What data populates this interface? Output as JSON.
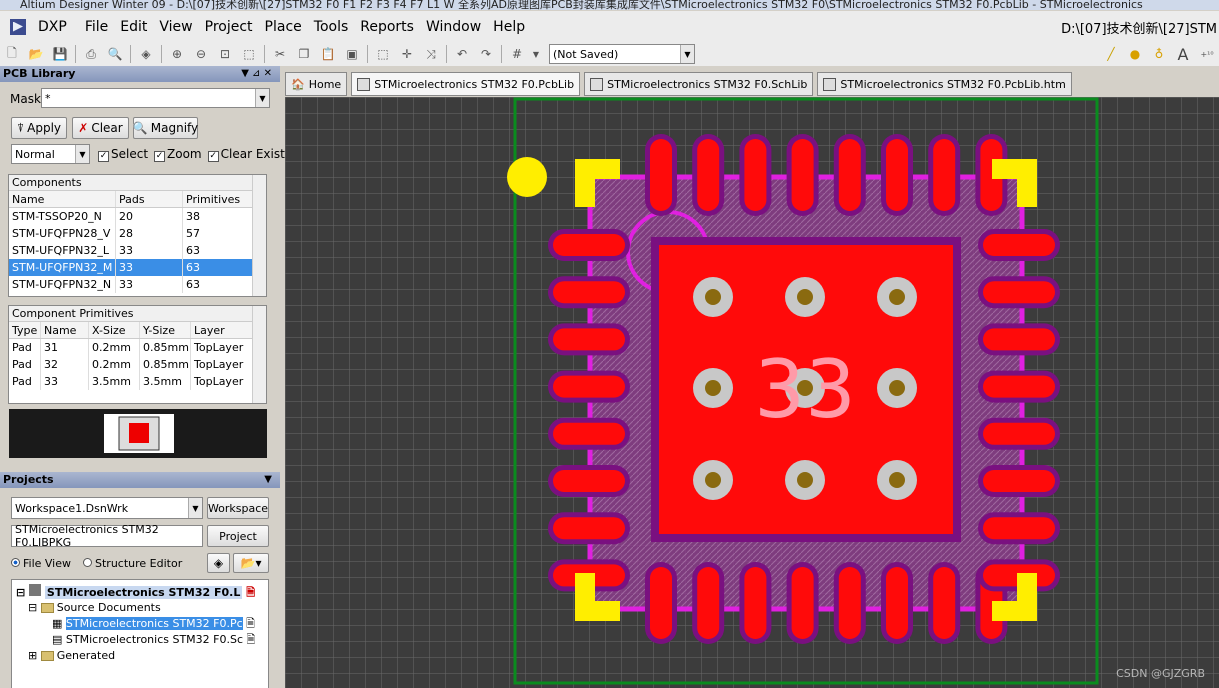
{
  "title": "Altium Designer Winter 09 - D:\\[07]技术创新\\[27]STM32 F0 F1 F2 F3 F4 F7 L1 W 全系列AD原理图库PCB封装库集成库文件\\STMicroelectronics STM32 F0\\STMicroelectronics STM32 F0.PcbLib - STMicroelectronics",
  "menu": {
    "dxp": "DXP",
    "file": "File",
    "edit": "Edit",
    "view": "View",
    "project": "Project",
    "place": "Place",
    "tools": "Tools",
    "reports": "Reports",
    "window": "Window",
    "help": "Help",
    "path": "D:\\[07]技术创新\\[27]STM"
  },
  "toolbar": {
    "saved": "(Not Saved)"
  },
  "pcblib": {
    "title": "PCB Library",
    "mask_label": "Mask",
    "mask_value": "*",
    "apply": "Apply",
    "clear": "Clear",
    "magnify": "Magnify",
    "mode": "Normal",
    "select": "Select",
    "zoom": "Zoom",
    "clear_existing": "Clear Existing"
  },
  "components": {
    "caption": "Components",
    "headers": [
      "Name",
      "Pads",
      "Primitives"
    ],
    "rows": [
      [
        "STM-TSSOP20_N",
        "20",
        "38"
      ],
      [
        "STM-UFQFPN28_V",
        "28",
        "57"
      ],
      [
        "STM-UFQFPN32_L",
        "33",
        "63"
      ],
      [
        "STM-UFQFPN32_M",
        "33",
        "63"
      ],
      [
        "STM-UFQFPN32_N",
        "33",
        "63"
      ]
    ]
  },
  "primitives": {
    "caption": "Component Primitives",
    "headers": [
      "Type",
      "Name",
      "X-Size",
      "Y-Size",
      "Layer"
    ],
    "rows": [
      [
        "Pad",
        "31",
        "0.2mm",
        "0.85mm",
        "TopLayer"
      ],
      [
        "Pad",
        "32",
        "0.2mm",
        "0.85mm",
        "TopLayer"
      ],
      [
        "Pad",
        "33",
        "3.5mm",
        "3.5mm",
        "TopLayer"
      ]
    ]
  },
  "projects": {
    "title": "Projects",
    "workspace_value": "Workspace1.DsnWrk",
    "workspace_btn": "Workspace",
    "project_value": "STMicroelectronics STM32 F0.LIBPKG",
    "project_btn": "Project",
    "file_view": "File View",
    "structure_editor": "Structure Editor",
    "tree": {
      "root": "STMicroelectronics STM32 F0.L",
      "source": "Source Documents",
      "doc1": "STMicroelectronics STM32 F0.Pc",
      "doc2": "STMicroelectronics STM32 F0.Sc",
      "generated": "Generated"
    }
  },
  "tabs": [
    "Home",
    "STMicroelectronics STM32 F0.PcbLib",
    "STMicroelectronics STM32 F0.SchLib",
    "STMicroelectronics STM32 F0.PcbLib.htm"
  ],
  "pcb": {
    "center_pad": "33"
  },
  "watermark": "CSDN @GJZGRB"
}
